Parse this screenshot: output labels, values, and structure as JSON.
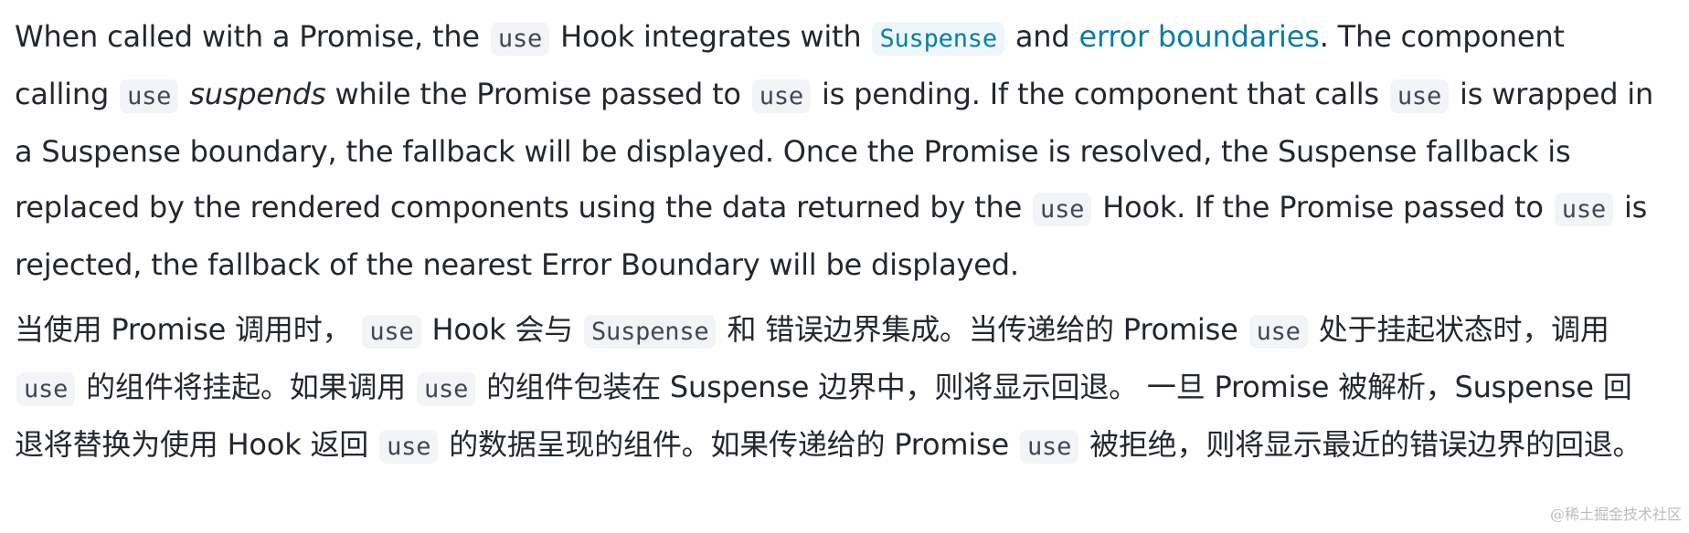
{
  "en": {
    "s1": "When called with a Promise, the",
    "code_use": "use",
    "s2": "Hook integrates with",
    "code_suspense": "Suspense",
    "s3": "and",
    "link_error_boundaries": "error boundaries",
    "s4": ". The component calling",
    "em_suspends": "suspends",
    "s5": "while the Promise passed to",
    "s6": "is pending. If the component that calls",
    "s7": "is wrapped in a Suspense boundary, the fallback will be displayed.  Once the Promise is resolved, the Suspense fallback is replaced by the rendered components using the data returned by the",
    "s8": "Hook. If the Promise passed to",
    "s9": "is rejected, the fallback of the nearest Error Boundary will be displayed."
  },
  "zh": {
    "s1": "当使用 Promise 调用时，",
    "s2": "Hook 会与",
    "s3": "和 错误边界集成。当传递给的 Promise",
    "s4": "处于挂起状态时，调用",
    "s5": "的组件将挂起。如果调用",
    "s6": "的组件包装在 Suspense 边界中，则将显示回退。 一旦 Promise 被解析，Suspense 回退将替换为使用 Hook 返回",
    "s7": "的数据呈现的组件。如果传递给的 Promise",
    "s8": "被拒绝，则将显示最近的错误边界的回退。"
  },
  "watermark": "@稀土掘金技术社区"
}
